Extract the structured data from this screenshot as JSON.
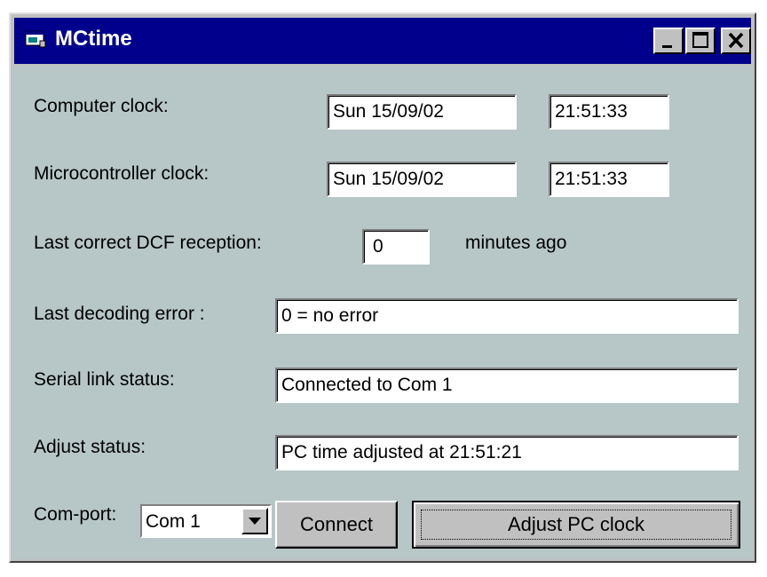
{
  "window": {
    "title": "MCtime",
    "icon": "app-window-icon",
    "controls": [
      "minimize-icon",
      "maximize-icon",
      "close-icon"
    ]
  },
  "computer_clock": {
    "label": "Computer clock:",
    "date": "Sun 15/09/02",
    "time": "21:51:33"
  },
  "micro_clock": {
    "label": "Microcontroller clock:",
    "date": "Sun 15/09/02",
    "time": "21:51:33"
  },
  "dcf": {
    "label": "Last correct DCF reception:",
    "value": "0",
    "suffix": "minutes ago"
  },
  "decoding_error": {
    "label": "Last decoding error :",
    "value": "0 = no error"
  },
  "serial_status": {
    "label": "Serial link status:",
    "value": "Connected to Com 1"
  },
  "adjust_status": {
    "label": "Adjust status:",
    "value": "PC time adjusted at 21:51:21"
  },
  "comport": {
    "label": "Com-port:",
    "selected": "Com 1"
  },
  "buttons": {
    "connect": "Connect",
    "adjust": "Adjust PC clock"
  },
  "colors": {
    "titlebar": "#00008c",
    "client": "#b7c6c6",
    "face": "#c0c0c0"
  }
}
